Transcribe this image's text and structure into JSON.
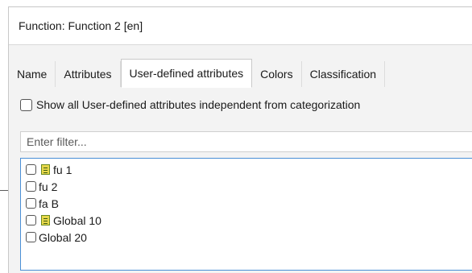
{
  "dialog": {
    "title": "Function: Function 2  [en]"
  },
  "tabs": [
    {
      "label": "Name",
      "active": false
    },
    {
      "label": "Attributes",
      "active": false
    },
    {
      "label": "User-defined attributes",
      "active": true
    },
    {
      "label": "Colors",
      "active": false
    },
    {
      "label": "Classification",
      "active": false
    }
  ],
  "show_all": {
    "label": "Show all User-defined attributes independent from categorization",
    "checked": false
  },
  "filter": {
    "placeholder": "Enter filter...",
    "value": ""
  },
  "attributes": [
    {
      "label": "fu 1",
      "icon": "attribute-icon",
      "checked": false
    },
    {
      "label": "fu 2",
      "icon": null,
      "checked": false
    },
    {
      "label": "fa B",
      "icon": null,
      "checked": false
    },
    {
      "label": "Global 10",
      "icon": "attribute-icon",
      "checked": false
    },
    {
      "label": "Global 20",
      "icon": null,
      "checked": false
    }
  ]
}
